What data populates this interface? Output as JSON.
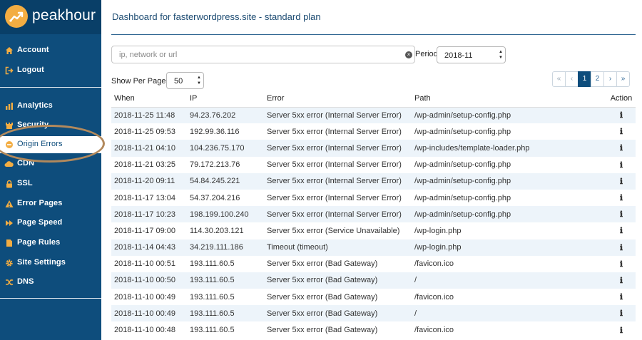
{
  "brand": {
    "name": "peakhour"
  },
  "nav": {
    "top": [
      {
        "label": "Account",
        "icon": "home-icon"
      },
      {
        "label": "Logout",
        "icon": "logout-icon"
      }
    ],
    "main": [
      {
        "label": "Analytics",
        "icon": "bar-chart-icon"
      },
      {
        "label": "Security",
        "icon": "castle-icon"
      },
      {
        "label": "Origin Errors",
        "icon": "minus-circle-icon",
        "active": true
      },
      {
        "label": "CDN",
        "icon": "cloud-icon"
      },
      {
        "label": "SSL",
        "icon": "lock-icon"
      },
      {
        "label": "Error Pages",
        "icon": "warning-icon"
      },
      {
        "label": "Page Speed",
        "icon": "fast-forward-icon"
      },
      {
        "label": "Page Rules",
        "icon": "file-icon"
      },
      {
        "label": "Site Settings",
        "icon": "gear-icon"
      },
      {
        "label": "DNS",
        "icon": "shuffle-icon"
      }
    ]
  },
  "page": {
    "title": "Dashboard for fasterwordpress.site - standard plan"
  },
  "filters": {
    "search_placeholder": "ip, network or url",
    "search_value": "",
    "period_label": "Period",
    "period_value": "2018-11",
    "per_page_label": "Show Per Page:",
    "per_page_value": "50"
  },
  "pagination": {
    "first": "«",
    "prev": "‹",
    "pages": [
      "1",
      "2"
    ],
    "current": "1",
    "next": "›",
    "last": "»"
  },
  "table": {
    "headers": {
      "when": "When",
      "ip": "IP",
      "error": "Error",
      "path": "Path",
      "action": "Action"
    },
    "rows": [
      {
        "when": "2018-11-25 11:48",
        "ip": "94.23.76.202",
        "error": "Server 5xx error (Internal Server Error)",
        "path": "/wp-admin/setup-config.php"
      },
      {
        "when": "2018-11-25 09:53",
        "ip": "192.99.36.116",
        "error": "Server 5xx error (Internal Server Error)",
        "path": "/wp-admin/setup-config.php"
      },
      {
        "when": "2018-11-21 04:10",
        "ip": "104.236.75.170",
        "error": "Server 5xx error (Internal Server Error)",
        "path": "/wp-includes/template-loader.php"
      },
      {
        "when": "2018-11-21 03:25",
        "ip": "79.172.213.76",
        "error": "Server 5xx error (Internal Server Error)",
        "path": "/wp-admin/setup-config.php"
      },
      {
        "when": "2018-11-20 09:11",
        "ip": "54.84.245.221",
        "error": "Server 5xx error (Internal Server Error)",
        "path": "/wp-admin/setup-config.php"
      },
      {
        "when": "2018-11-17 13:04",
        "ip": "54.37.204.216",
        "error": "Server 5xx error (Internal Server Error)",
        "path": "/wp-admin/setup-config.php"
      },
      {
        "when": "2018-11-17 10:23",
        "ip": "198.199.100.240",
        "error": "Server 5xx error (Internal Server Error)",
        "path": "/wp-admin/setup-config.php"
      },
      {
        "when": "2018-11-17 09:00",
        "ip": "114.30.203.121",
        "error": "Server 5xx error (Service Unavailable)",
        "path": "/wp-login.php"
      },
      {
        "when": "2018-11-14 04:43",
        "ip": "34.219.111.186",
        "error": "Timeout (timeout)",
        "path": "/wp-login.php"
      },
      {
        "when": "2018-11-10 00:51",
        "ip": "193.111.60.5",
        "error": "Server 5xx error (Bad Gateway)",
        "path": "/favicon.ico"
      },
      {
        "when": "2018-11-10 00:50",
        "ip": "193.111.60.5",
        "error": "Server 5xx error (Bad Gateway)",
        "path": "/"
      },
      {
        "when": "2018-11-10 00:49",
        "ip": "193.111.60.5",
        "error": "Server 5xx error (Bad Gateway)",
        "path": "/favicon.ico"
      },
      {
        "when": "2018-11-10 00:49",
        "ip": "193.111.60.5",
        "error": "Server 5xx error (Bad Gateway)",
        "path": "/"
      },
      {
        "when": "2018-11-10 00:48",
        "ip": "193.111.60.5",
        "error": "Server 5xx error (Bad Gateway)",
        "path": "/favicon.ico"
      }
    ],
    "action_icon": "info-icon",
    "action_glyph": "ℹ"
  },
  "colors": {
    "sidebar": "#0e4d7c",
    "brand_bar": "#093f68",
    "accent": "#f3ad42",
    "row_stripe": "#edf4fa",
    "highlight_ring": "#b2895c"
  }
}
